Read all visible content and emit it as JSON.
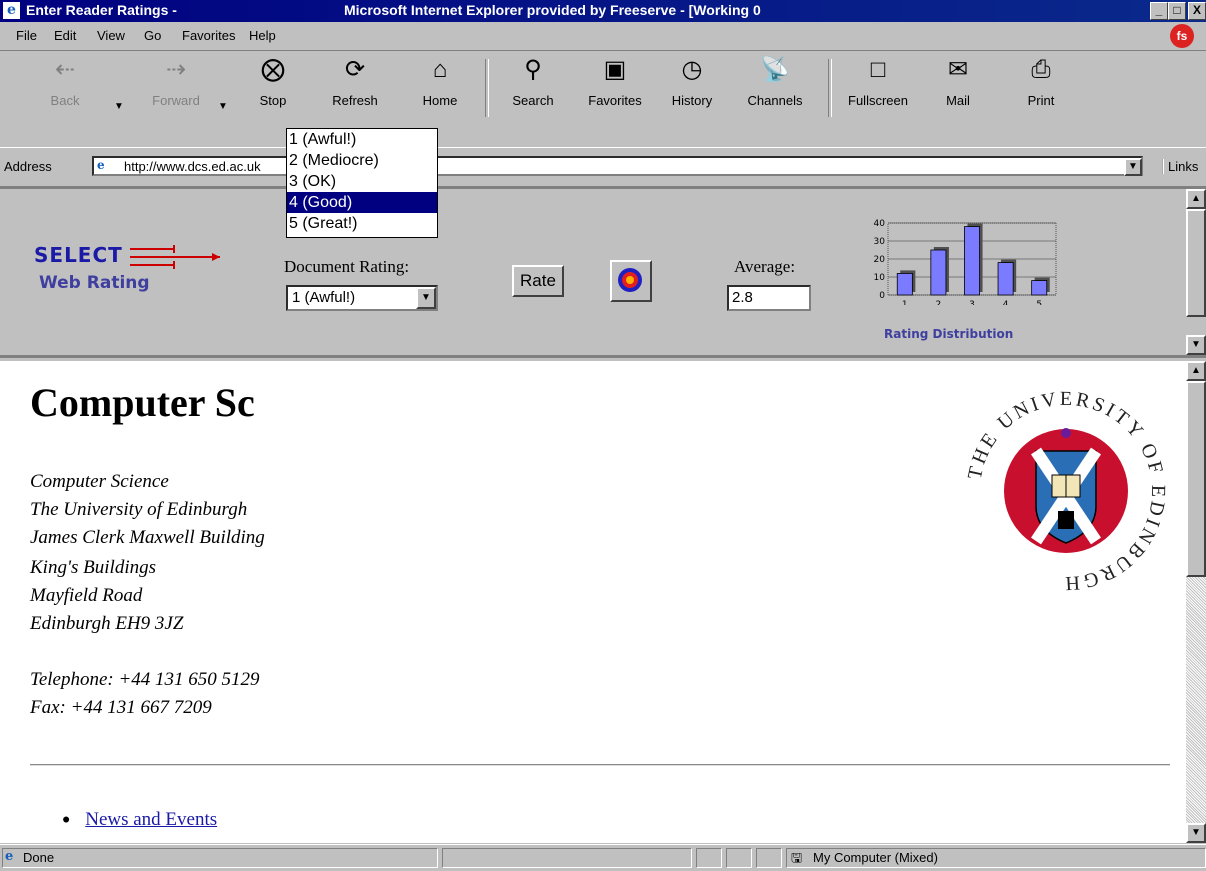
{
  "window": {
    "title_left": "Enter Reader Ratings -",
    "title_right": "Microsoft Internet Explorer provided by Freeserve - [Working 0",
    "controls": [
      "_",
      "□",
      "X"
    ]
  },
  "menu": [
    "File",
    "Edit",
    "View",
    "Go",
    "Favorites",
    "Help"
  ],
  "toolbar": [
    {
      "label": "Back",
      "icon": "back-arrow-icon",
      "enabled": false
    },
    {
      "label": "Forward",
      "icon": "forward-arrow-icon",
      "enabled": false
    },
    {
      "label": "Stop",
      "icon": "stop-icon",
      "enabled": true
    },
    {
      "label": "Refresh",
      "icon": "refresh-icon",
      "enabled": true
    },
    {
      "label": "Home",
      "icon": "home-icon",
      "enabled": true
    },
    {
      "label": "Search",
      "icon": "search-icon",
      "enabled": true
    },
    {
      "label": "Favorites",
      "icon": "favorites-icon",
      "enabled": true
    },
    {
      "label": "History",
      "icon": "history-icon",
      "enabled": true
    },
    {
      "label": "Channels",
      "icon": "channels-icon",
      "enabled": true
    },
    {
      "label": "Fullscreen",
      "icon": "fullscreen-icon",
      "enabled": true
    },
    {
      "label": "Mail",
      "icon": "mail-icon",
      "enabled": true
    },
    {
      "label": "Print",
      "icon": "print-icon",
      "enabled": true
    }
  ],
  "address": {
    "label": "Address",
    "url": "http://www.dcs.ed.ac.uk",
    "links_label": "Links"
  },
  "rating_widget": {
    "logo_line1": "SELECT",
    "logo_line2": "Web Rating",
    "document_rating_label": "Document Rating:",
    "selected_value": "1 (Awful!)",
    "options": [
      "1 (Awful!)",
      "2 (Mediocre)",
      "3 (OK)",
      "4 (Good)",
      "5 (Great!)"
    ],
    "highlighted_option": 3,
    "rate_button": "Rate",
    "average_label": "Average:",
    "average_value": "2.8",
    "chart_caption": "Rating Distribution"
  },
  "chart_data": {
    "type": "bar",
    "categories": [
      "1",
      "2",
      "3",
      "4",
      "5"
    ],
    "values": [
      12,
      25,
      38,
      18,
      8
    ],
    "yticks": [
      "40",
      "30",
      "20",
      "10",
      "0"
    ],
    "ylim": [
      0,
      40
    ],
    "title": "Rating Distribution",
    "bar_color": "#7b7bff"
  },
  "page": {
    "heading": "Computer Sc",
    "address_lines": [
      "Computer Science",
      "The University of Edinburgh",
      "James Clerk Maxwell Building",
      "King's Buildings",
      "Mayfield Road",
      "Edinburgh EH9 3JZ"
    ],
    "telephone": "Telephone: +44 131 650 5129",
    "fax": "Fax: +44 131 667 7209",
    "links": [
      "News and Events"
    ],
    "seal_text": "THE UNIVERSITY OF EDINBURGH"
  },
  "status": {
    "left": "Done",
    "zone": "My Computer (Mixed)"
  },
  "colors": {
    "titlebar": "#000080",
    "logo_blue": "#1a1aa6",
    "logo_red": "#cc0000",
    "seal_red": "#c8102e",
    "seal_blue": "#2a6fb5"
  }
}
